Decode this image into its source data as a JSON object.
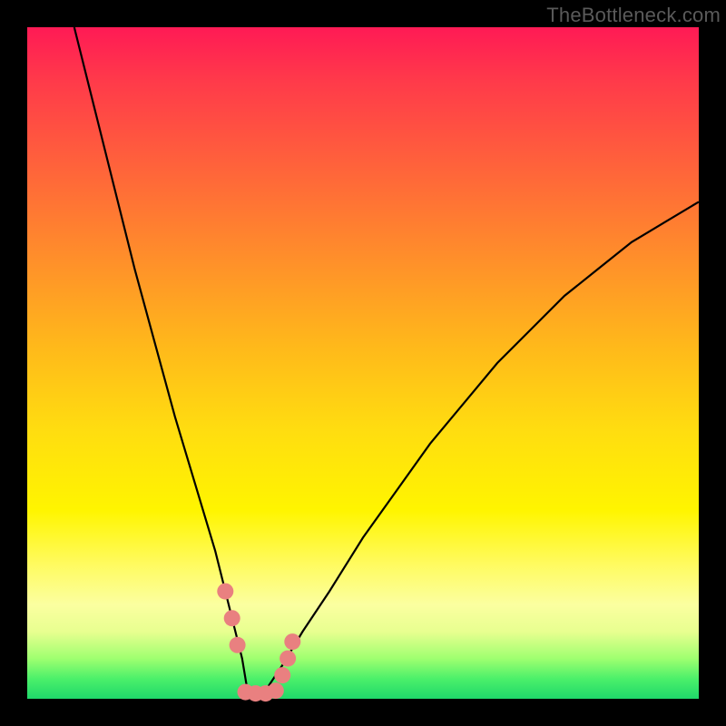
{
  "watermark": "TheBottleneck.com",
  "colors": {
    "frame": "#000000",
    "curve": "#000000",
    "marker": "#e98080",
    "gradient_top": "#ff1a55",
    "gradient_bottom": "#1fd86a"
  },
  "chart_data": {
    "type": "line",
    "title": "",
    "xlabel": "",
    "ylabel": "",
    "xlim": [
      0,
      100
    ],
    "ylim": [
      0,
      100
    ],
    "minimum_x": 33,
    "series": [
      {
        "name": "bottleneck-curve",
        "x": [
          7,
          10,
          13,
          16,
          19,
          22,
          25,
          28,
          30,
          31,
          32,
          33,
          34,
          35,
          36,
          38,
          41,
          45,
          50,
          55,
          60,
          65,
          70,
          75,
          80,
          85,
          90,
          95,
          100
        ],
        "y": [
          100,
          88,
          76,
          64,
          53,
          42,
          32,
          22,
          14,
          10,
          6,
          0,
          0,
          0,
          2,
          5,
          10,
          16,
          24,
          31,
          38,
          44,
          50,
          55,
          60,
          64,
          68,
          71,
          74
        ]
      }
    ],
    "markers": [
      {
        "name": "left-approach-top",
        "x": 29.5,
        "y": 16
      },
      {
        "name": "left-approach-mid",
        "x": 30.5,
        "y": 12
      },
      {
        "name": "left-approach-low",
        "x": 31.3,
        "y": 8
      },
      {
        "name": "floor-a",
        "x": 32.5,
        "y": 1
      },
      {
        "name": "floor-b",
        "x": 34.0,
        "y": 0.8
      },
      {
        "name": "floor-c",
        "x": 35.5,
        "y": 0.8
      },
      {
        "name": "floor-d",
        "x": 37.0,
        "y": 1.2
      },
      {
        "name": "right-rise-low",
        "x": 38.0,
        "y": 3.5
      },
      {
        "name": "right-rise-mid",
        "x": 38.8,
        "y": 6
      },
      {
        "name": "right-rise-top",
        "x": 39.5,
        "y": 8.5
      }
    ]
  }
}
